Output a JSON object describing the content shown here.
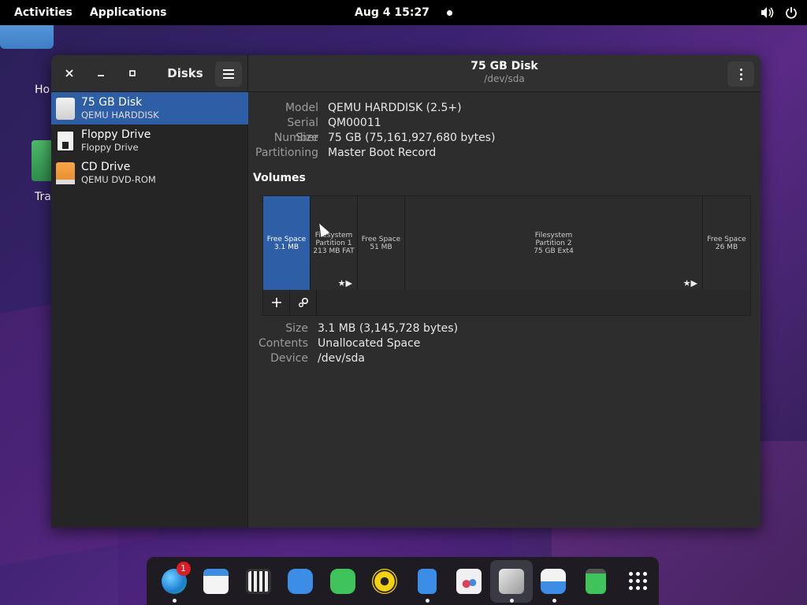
{
  "topbar": {
    "activities": "Activities",
    "applications": "Applications",
    "clock": "Aug 4  15:27"
  },
  "desktop": {
    "home_label": "Ho",
    "trash_label": "Tra"
  },
  "sidebar": {
    "title": "Disks",
    "devices": [
      {
        "name": "75 GB Disk",
        "sub": "QEMU HARDDISK"
      },
      {
        "name": "Floppy Drive",
        "sub": "Floppy Drive"
      },
      {
        "name": "CD Drive",
        "sub": "QEMU DVD-ROM"
      }
    ]
  },
  "main": {
    "title": "75 GB Disk",
    "subtitle": "/dev/sda",
    "props": [
      {
        "key": "Model",
        "value": "QEMU HARDDISK (2.5+)"
      },
      {
        "key": "Serial Number",
        "value": "QM00011"
      },
      {
        "key": "Size",
        "value": "75 GB (75,161,927,680 bytes)"
      },
      {
        "key": "Partitioning",
        "value": "Master Boot Record"
      }
    ],
    "volumes_title": "Volumes",
    "segments": [
      {
        "l1": "Free Space",
        "l2": "3.1 MB",
        "l3": ""
      },
      {
        "l1": "Filesystem",
        "l2": "Partition 1",
        "l3": "213 MB FAT"
      },
      {
        "l1": "Free Space",
        "l2": "51 MB",
        "l3": ""
      },
      {
        "l1": "Filesystem",
        "l2": "Partition 2",
        "l3": "75 GB Ext4"
      },
      {
        "l1": "Free Space",
        "l2": "26 MB",
        "l3": ""
      }
    ],
    "selected_props": [
      {
        "key": "Size",
        "value": "3.1 MB (3,145,728 bytes)"
      },
      {
        "key": "Contents",
        "value": "Unallocated Space"
      },
      {
        "key": "Device",
        "value": "/dev/sda"
      }
    ]
  },
  "dock": {
    "badge_count": "1"
  },
  "colors": {
    "selection": "#2e5ea6",
    "window_bg": "#2d2d2d",
    "sidebar_bg": "#252525"
  }
}
